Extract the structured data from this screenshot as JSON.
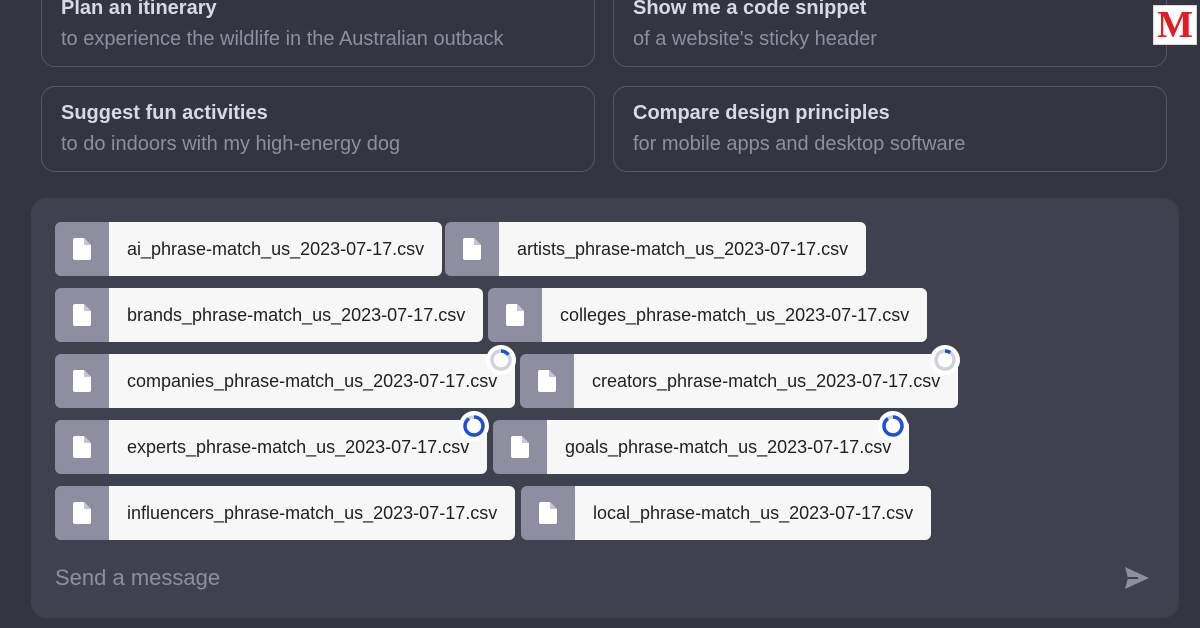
{
  "suggestions": [
    {
      "title": "Plan an itinerary",
      "subtitle": "to experience the wildlife in the Australian outback"
    },
    {
      "title": "Show me a code snippet",
      "subtitle": "of a website's sticky header"
    },
    {
      "title": "Suggest fun activities",
      "subtitle": "to do indoors with my high-energy dog"
    },
    {
      "title": "Compare design principles",
      "subtitle": "for mobile apps and desktop software"
    }
  ],
  "files": [
    {
      "name": "ai_phrase-match_us_2023-07-17.csv",
      "icon": "document-icon",
      "status": "uploaded"
    },
    {
      "name": "artists_phrase-match_us_2023-07-17.csv",
      "icon": "document-icon",
      "status": "uploaded"
    },
    {
      "name": "brands_phrase-match_us_2023-07-17.csv",
      "icon": "document-icon",
      "status": "uploaded"
    },
    {
      "name": "colleges_phrase-match_us_2023-07-17.csv",
      "icon": "document-icon",
      "status": "uploaded"
    },
    {
      "name": "companies_phrase-match_us_2023-07-17.csv",
      "icon": "document-icon",
      "status": "uploading",
      "progress": 0.15
    },
    {
      "name": "creators_phrase-match_us_2023-07-17.csv",
      "icon": "document-icon",
      "status": "uploading",
      "progress": 0.1
    },
    {
      "name": "experts_phrase-match_us_2023-07-17.csv",
      "icon": "document-icon",
      "status": "uploading",
      "progress": 0.9
    },
    {
      "name": "goals_phrase-match_us_2023-07-17.csv",
      "icon": "document-icon",
      "status": "uploading",
      "progress": 0.9
    },
    {
      "name": "influencers_phrase-match_us_2023-07-17.csv",
      "icon": "document-icon",
      "status": "uploaded"
    },
    {
      "name": "local_phrase-match_us_2023-07-17.csv",
      "icon": "document-icon",
      "status": "uploaded"
    }
  ],
  "composer": {
    "placeholder": "Send a message",
    "send_icon": "send-icon"
  },
  "logo": {
    "letter": "M",
    "color": "#e31b23"
  },
  "colors": {
    "background": "#343541",
    "composer": "#40414f",
    "progress": "#1d4fd8"
  }
}
